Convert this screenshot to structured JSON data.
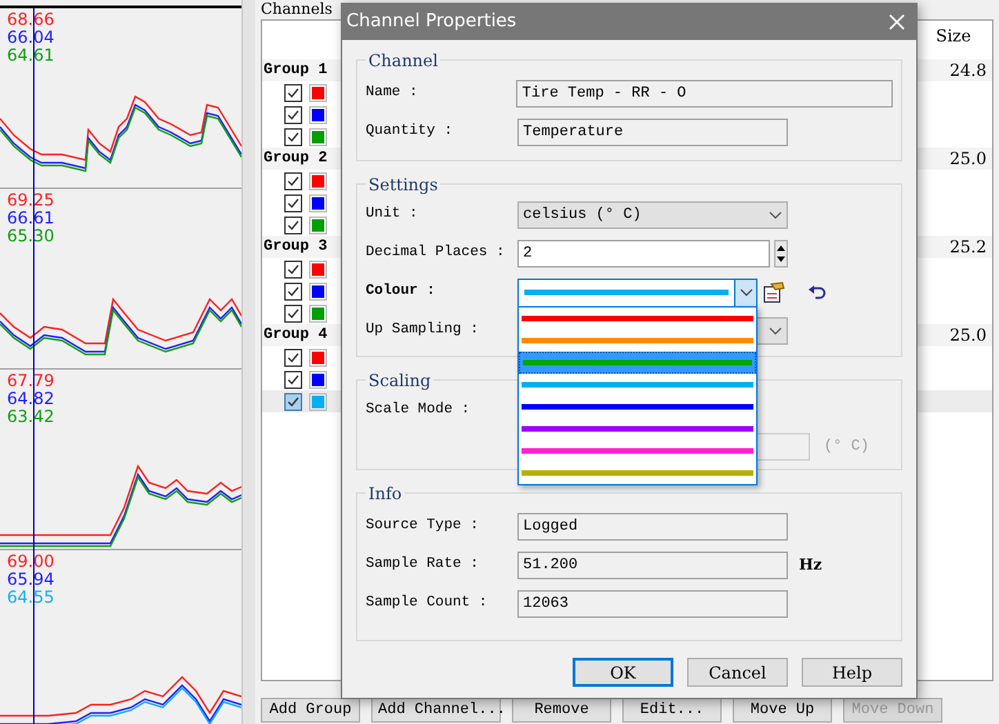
{
  "plots": [
    {
      "readings": [
        {
          "value": "68.66",
          "color": "#ff2020"
        },
        {
          "value": "66.04",
          "color": "#2020ff"
        },
        {
          "value": "64.61",
          "color": "#10a010"
        }
      ]
    },
    {
      "readings": [
        {
          "value": "69.25",
          "color": "#ff2020"
        },
        {
          "value": "66.61",
          "color": "#2020ff"
        },
        {
          "value": "65.30",
          "color": "#10a010"
        }
      ]
    },
    {
      "readings": [
        {
          "value": "67.79",
          "color": "#ff2020"
        },
        {
          "value": "64.82",
          "color": "#2020ff"
        },
        {
          "value": "63.42",
          "color": "#10a010"
        }
      ]
    },
    {
      "readings": [
        {
          "value": "69.00",
          "color": "#ff2020"
        },
        {
          "value": "65.94",
          "color": "#2020ff"
        },
        {
          "value": "64.55",
          "color": "#10b0f0"
        }
      ]
    }
  ],
  "channels_panel": {
    "title": "Channels",
    "size_header": "Size",
    "groups": [
      {
        "name": "Group 1",
        "size": "24.8",
        "items": [
          {
            "checked": true,
            "selected": false,
            "color": "#ff0000"
          },
          {
            "checked": true,
            "selected": false,
            "color": "#0000ff"
          },
          {
            "checked": true,
            "selected": false,
            "color": "#00a000"
          }
        ]
      },
      {
        "name": "Group 2",
        "size": "25.0",
        "items": [
          {
            "checked": true,
            "selected": false,
            "color": "#ff0000"
          },
          {
            "checked": true,
            "selected": false,
            "color": "#0000ff"
          },
          {
            "checked": true,
            "selected": false,
            "color": "#00a000"
          }
        ]
      },
      {
        "name": "Group 3",
        "size": "25.2",
        "items": [
          {
            "checked": true,
            "selected": false,
            "color": "#ff0000"
          },
          {
            "checked": true,
            "selected": false,
            "color": "#0000ff"
          },
          {
            "checked": true,
            "selected": false,
            "color": "#00a000"
          }
        ]
      },
      {
        "name": "Group 4",
        "size": "25.0",
        "items": [
          {
            "checked": true,
            "selected": false,
            "color": "#ff0000"
          },
          {
            "checked": true,
            "selected": false,
            "color": "#0000ff"
          },
          {
            "checked": true,
            "selected": true,
            "color": "#00b0f0"
          }
        ]
      }
    ]
  },
  "buttons": [
    {
      "label": "Add Group",
      "disabled": false
    },
    {
      "label": "Add Channel...",
      "disabled": false
    },
    {
      "label": "Remove",
      "disabled": false
    },
    {
      "label": "Edit...",
      "disabled": false
    },
    {
      "label": "Move Up",
      "disabled": false
    },
    {
      "label": "Move Down",
      "disabled": true
    }
  ],
  "dialog": {
    "title": "Channel Properties",
    "channel": {
      "title": "Channel",
      "name_label": "Name :",
      "name_value": "Tire Temp - RR - O",
      "quantity_label": "Quantity :",
      "quantity_value": "Temperature"
    },
    "settings": {
      "title": "Settings",
      "unit_label": "Unit :",
      "unit_value": "celsius (° C)",
      "decimal_label": "Decimal Places :",
      "decimal_value": "2",
      "colour_label": "Colour :",
      "colour_selected": {
        "color": "#00b0f0"
      },
      "up_sampling_label": "Up Sampling :",
      "colour_options": [
        {
          "color": "#ff0000",
          "selected": false
        },
        {
          "color": "#ff8c00",
          "selected": false
        },
        {
          "color": "#00a800",
          "selected": true
        },
        {
          "color": "#00b0f0",
          "selected": false
        },
        {
          "color": "#0000ff",
          "selected": false
        },
        {
          "color": "#a000ff",
          "selected": false
        },
        {
          "color": "#ff20d0",
          "selected": false
        },
        {
          "color": "#b8b000",
          "selected": false
        }
      ]
    },
    "scaling": {
      "title": "Scaling",
      "scale_mode_label": "Scale Mode :",
      "unit_text": "(° C)"
    },
    "info": {
      "title": "Info",
      "source_type_label": "Source Type :",
      "source_type_value": "Logged",
      "sample_rate_label": "Sample Rate :",
      "sample_rate_value": "51.200",
      "sample_rate_unit": "Hz",
      "sample_count_label": "Sample Count :",
      "sample_count_value": "12063"
    },
    "buttons": [
      {
        "label": "OK",
        "default": true
      },
      {
        "label": "Cancel",
        "default": false
      },
      {
        "label": "Help",
        "default": false
      }
    ]
  }
}
